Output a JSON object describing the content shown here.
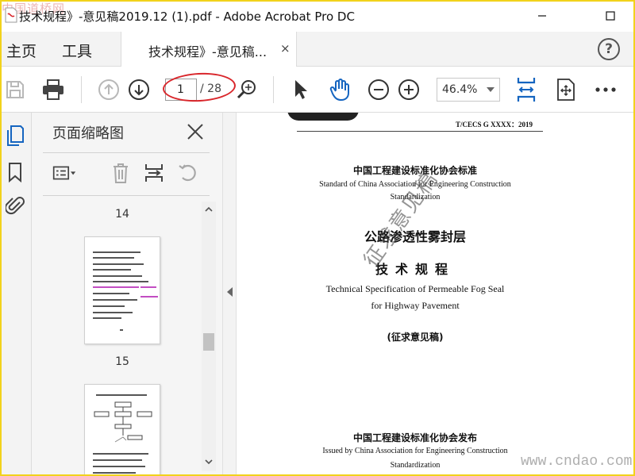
{
  "window": {
    "title": "技术规程》-意见稿2019.12 (1).pdf - Adobe Acrobat Pro DC",
    "watermark_top": "中国道桥网"
  },
  "tabs": {
    "home": "主页",
    "tools": "工具",
    "document": "技术规程》-意见稿...",
    "close_symbol": "×",
    "help_symbol": "?"
  },
  "toolbar": {
    "current_page": "1",
    "total_pages": "/ 28",
    "zoom": "46.4%"
  },
  "thumbnails_panel": {
    "title": "页面缩略图",
    "pages": [
      {
        "number": "14"
      },
      {
        "number": "15"
      }
    ]
  },
  "document": {
    "standard_code": "T/CECS G XXXX：2019",
    "assoc_cn": "中国工程建设标准化协会标准",
    "assoc_en_1": "Standard of China Association for Engineering Construction",
    "assoc_en_2": "Standardization",
    "title_cn": "公路渗透性雾封层",
    "subtitle_cn": "技术规程",
    "title_en_1": "Technical Specification of Permeable Fog Seal",
    "title_en_2": "for Highway Pavement",
    "draft_label": "(征求意见稿)",
    "issuer_cn": "中国工程建设标准化协会发布",
    "issuer_en_1": "Issued by China Association for Engineering Construction",
    "issuer_en_2": "Standardization",
    "diagonal_watermark": "征求意见稿",
    "site_watermark": "www.cndao.com"
  },
  "colors": {
    "accent_blue": "#1565c0",
    "annotation_red": "#d9262b",
    "frame_yellow": "#f2d21b"
  }
}
